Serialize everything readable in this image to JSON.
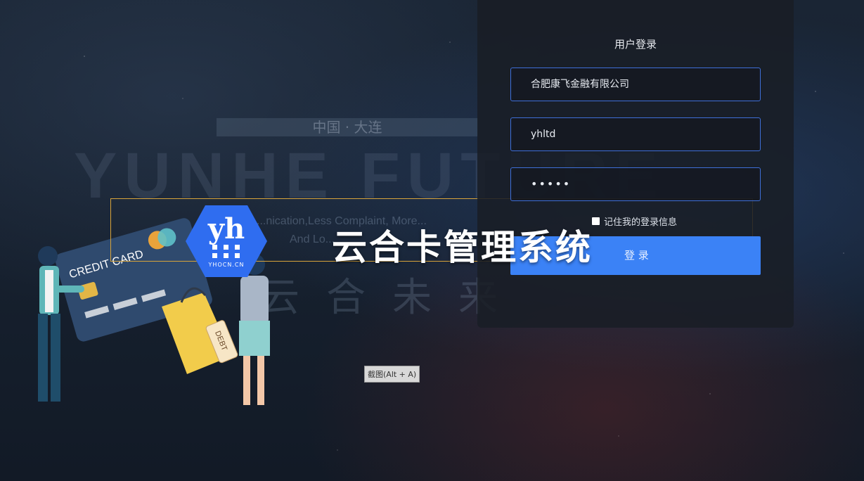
{
  "watermark": {
    "city": "中国 · 大连",
    "brand": "YUNHE FUTURE",
    "slogan_line1": "...nication,Less Complaint, More...",
    "slogan_line2": "And Lo...",
    "brand_cn": "云合未来"
  },
  "login": {
    "title": "用户登录",
    "company": "合肥康飞金融有限公司",
    "username": "yhltd",
    "password_mask": "•••••",
    "remember_label": "记住我的登录信息",
    "submit_label": "登 录"
  },
  "overlay_title": "云合卡管理系统",
  "logo": {
    "text": "yh",
    "url": "YHOCN.CN",
    "color": "#2f6df0"
  },
  "illustration": {
    "card_text": "CREDIT CARD",
    "tag_text": "DEBT"
  },
  "tooltip": "截图(Alt + A)"
}
